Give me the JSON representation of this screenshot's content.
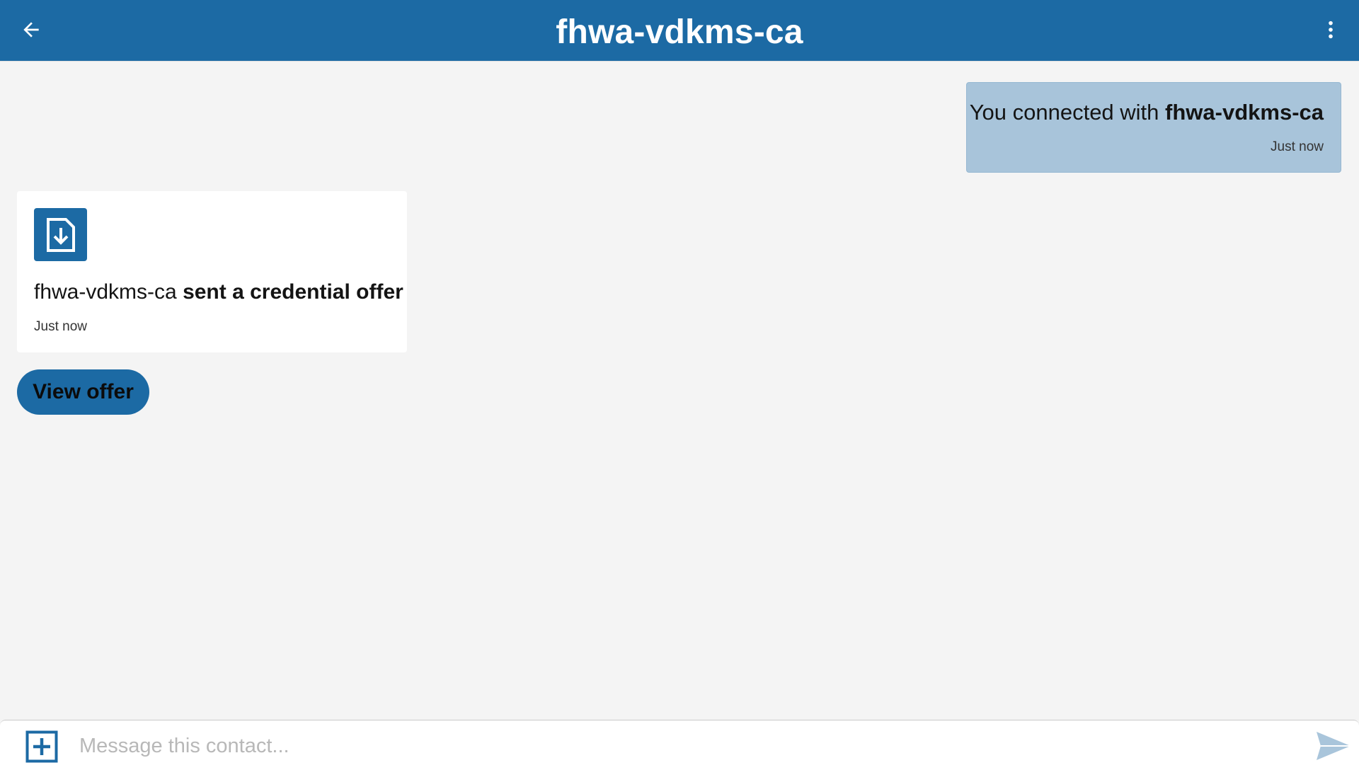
{
  "header": {
    "title": "fhwa-vdkms-ca",
    "back_icon": "arrow-left-icon",
    "menu_icon": "more-vertical-icon",
    "background": "#1c6aa4"
  },
  "messages": {
    "connected": {
      "prefix": "You connected with ",
      "contact": "fhwa-vdkms-ca",
      "time": "Just now",
      "background": "#a8c4da"
    },
    "offer": {
      "icon": "credential-download-icon",
      "sender": "fhwa-vdkms-ca",
      "action": "sent a credential offer",
      "time": "Just now",
      "button_label": "View offer"
    }
  },
  "composer": {
    "placeholder": "Message this contact...",
    "attach_icon": "plus-square-icon",
    "send_icon": "send-icon"
  }
}
